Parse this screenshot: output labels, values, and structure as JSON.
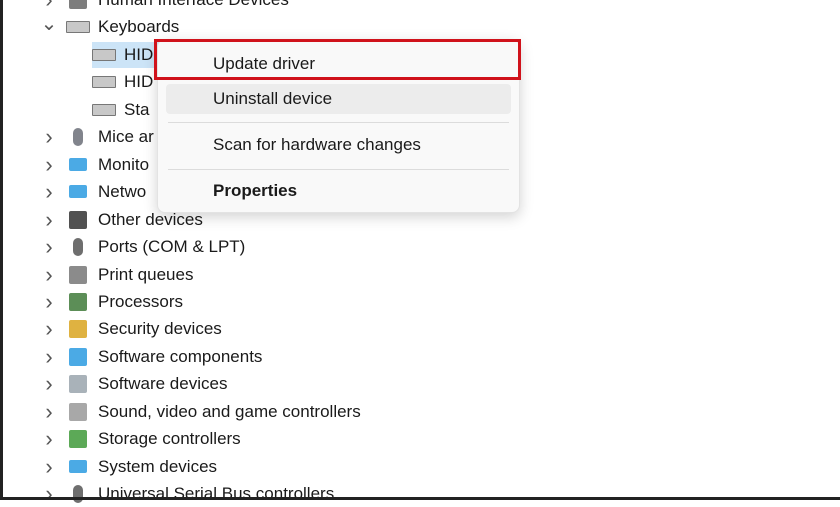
{
  "tree": {
    "partial_top": {
      "label": "Human Interface Devices",
      "icon": "hid-icon"
    },
    "keyboards": {
      "label": "Keyboards",
      "icon": "keyboard-icon",
      "expanded": true,
      "children": [
        {
          "label": "HID",
          "icon": "keyboard-icon",
          "selected": true
        },
        {
          "label": "HID",
          "icon": "keyboard-icon"
        },
        {
          "label": "Sta",
          "icon": "keyboard-icon"
        }
      ]
    },
    "categories": [
      {
        "label": "Mice ar",
        "icon": "mouse-icon",
        "color": "#6b6f78"
      },
      {
        "label": "Monito",
        "icon": "monitor-icon",
        "color": "#2b9be0"
      },
      {
        "label": "Netwo",
        "icon": "network-icon",
        "color": "#2b9be0"
      },
      {
        "label": "Other devices",
        "icon": "unknown-device-icon",
        "color": "#333333"
      },
      {
        "label": "Ports (COM & LPT)",
        "icon": "port-icon",
        "color": "#555555"
      },
      {
        "label": "Print queues",
        "icon": "printer-icon",
        "color": "#777777"
      },
      {
        "label": "Processors",
        "icon": "processor-icon",
        "color": "#3f7a3a"
      },
      {
        "label": "Security devices",
        "icon": "security-device-icon",
        "color": "#d9a520"
      },
      {
        "label": "Software components",
        "icon": "software-component-icon",
        "color": "#2b9be0"
      },
      {
        "label": "Software devices",
        "icon": "software-device-icon",
        "color": "#9aa4ad"
      },
      {
        "label": "Sound, video and game controllers",
        "icon": "speaker-icon",
        "color": "#999999"
      },
      {
        "label": "Storage controllers",
        "icon": "storage-controller-icon",
        "color": "#3f9a3a"
      },
      {
        "label": "System devices",
        "icon": "system-device-icon",
        "color": "#2b9be0"
      },
      {
        "label": "Universal Serial Bus controllers",
        "icon": "usb-icon",
        "color": "#555555"
      }
    ]
  },
  "context_menu": {
    "items": [
      {
        "label": "Update driver",
        "highlighted_box": true
      },
      {
        "label": "Uninstall device",
        "hover": true
      },
      {
        "label": "Scan for hardware changes"
      },
      {
        "label": "Properties",
        "bold": true
      }
    ],
    "highlight_color": "#d0121b"
  }
}
